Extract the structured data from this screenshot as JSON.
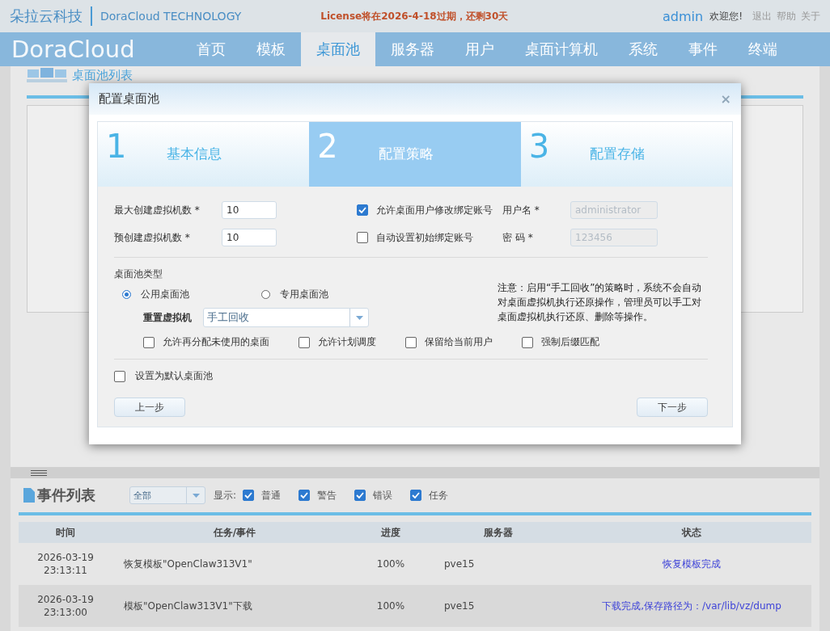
{
  "header": {
    "brand_cn": "朵拉云科技",
    "brand_en": "DoraCloud TECHNOLOGY",
    "license_notice": "License将在2026-4-18过期，还剩30天",
    "user": "admin",
    "welcome": "欢迎您!",
    "links": [
      "退出",
      "帮助",
      "关于"
    ]
  },
  "nav": {
    "logo": "DoraCloud",
    "items": [
      {
        "label": "首页",
        "selected": false
      },
      {
        "label": "模板",
        "selected": false
      },
      {
        "label": "桌面池",
        "selected": true
      },
      {
        "label": "服务器",
        "selected": false
      },
      {
        "label": "用户",
        "selected": false
      },
      {
        "label": "桌面计算机",
        "selected": false
      },
      {
        "label": "系统",
        "selected": false
      },
      {
        "label": "事件",
        "selected": false
      },
      {
        "label": "终端",
        "selected": false
      }
    ]
  },
  "pool_list": {
    "title": "桌面池列表"
  },
  "dialog": {
    "title": "配置桌面池",
    "close": "×",
    "steps": [
      {
        "number": "1",
        "label": "基本信息",
        "selected": false
      },
      {
        "number": "2",
        "label": "配置策略",
        "selected": true
      },
      {
        "number": "3",
        "label": "配置存储",
        "selected": false
      }
    ],
    "max_vms": {
      "label": "最大创建虚拟机数 *",
      "value": "10"
    },
    "precreate": {
      "label": "预创建虚拟机数 *",
      "value": "10"
    },
    "allow_modify": {
      "label": "允许桌面用户修改绑定账号",
      "checked": true
    },
    "auto_bind": {
      "label": "自动设置初始绑定账号",
      "checked": false
    },
    "username": {
      "label": "用户名 *",
      "value": "administrator",
      "disabled": true
    },
    "password": {
      "label": "密 码 *",
      "value": "123456",
      "disabled": true
    },
    "pool_type": {
      "label": "桌面池类型",
      "options": [
        {
          "label": "公用桌面池",
          "selected": true
        },
        {
          "label": "专用桌面池",
          "selected": false
        }
      ]
    },
    "reset": {
      "label": "重置虚拟机",
      "value": "手工回收"
    },
    "note": "注意：启用“手工回收”的策略时，系统不会自动对桌面虚拟机执行还原操作，管理员可以手工对桌面虚拟机执行还原、删除等操作。",
    "options": [
      {
        "label": "允许再分配未使用的桌面",
        "checked": false
      },
      {
        "label": "允许计划调度",
        "checked": false
      },
      {
        "label": "保留给当前用户",
        "checked": false
      },
      {
        "label": "强制后缀匹配",
        "checked": false
      }
    ],
    "default_pool": {
      "label": "设置为默认桌面池",
      "checked": false
    },
    "prev": "上一步",
    "next": "下一步"
  },
  "events": {
    "title": "事件列表",
    "filter": "全部",
    "show_label": "显示:",
    "filters": [
      {
        "label": "普通",
        "checked": true
      },
      {
        "label": "警告",
        "checked": true
      },
      {
        "label": "错误",
        "checked": true
      },
      {
        "label": "任务",
        "checked": true
      }
    ],
    "columns": [
      "时间",
      "任务/事件",
      "进度",
      "服务器",
      "状态"
    ],
    "rows": [
      {
        "time": "2026-03-19 23:13:11",
        "event": "恢复模板\"OpenClaw313V1\"",
        "progress": "100%",
        "server": "pve15",
        "status": "恢复模板完成"
      },
      {
        "time": "2026-03-19 23:13:00",
        "event": "模板\"OpenClaw313V1\"下载",
        "progress": "100%",
        "server": "pve15",
        "status": "下载完成,保存路径为：/var/lib/vz/dump"
      }
    ]
  }
}
